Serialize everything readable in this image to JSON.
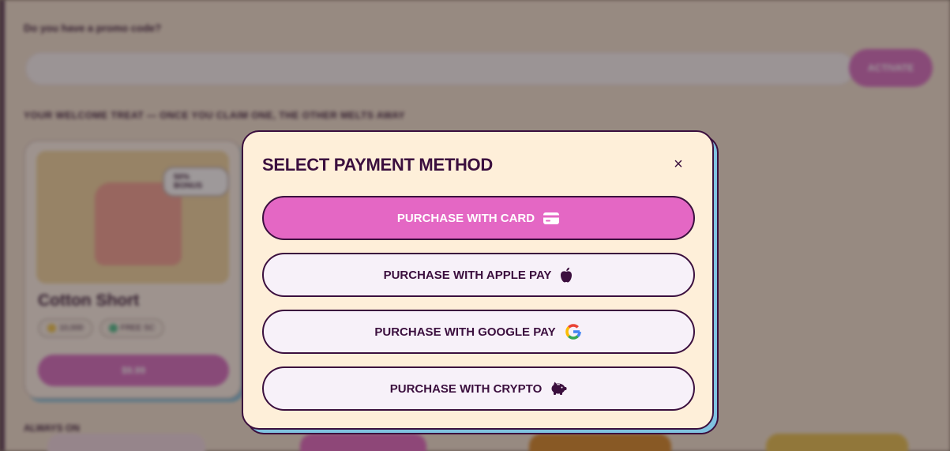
{
  "background": {
    "promo_question": "Do you have a promo code?",
    "promo_input_placeholder": "",
    "activate_label": "ACTIVATE",
    "welcome_heading": "YOUR WELCOME TREAT — ONCE YOU CLAIM ONE, THE OTHER MELTS AWAY",
    "offer": {
      "badge": "50% BONUS",
      "title": "Cotton Short",
      "chips": [
        {
          "label": "10,000",
          "icon": "coin-icon",
          "color": "#f2c94c"
        },
        {
          "label": "FREE SC",
          "icon": "sweep-coin-icon",
          "color": "#4fc08d"
        }
      ],
      "price": "$9.99"
    },
    "always_heading": "ALWAYS ON"
  },
  "modal": {
    "title": "SELECT PAYMENT METHOD",
    "close_icon": "×",
    "buttons": [
      {
        "label": "PURCHASE WITH CARD",
        "icon": "credit-card-icon"
      },
      {
        "label": "PURCHASE WITH APPLE PAY",
        "icon": "apple-icon"
      },
      {
        "label": "PURCHASE WITH GOOGLE PAY",
        "icon": "google-icon"
      },
      {
        "label": "PURCHASE WITH CRYPTO",
        "icon": "piggy-bank-icon"
      }
    ]
  },
  "colors": {
    "accent_pink": "#e467c4",
    "dark_purple": "#3b0f3e",
    "modal_bg": "#feefd9",
    "shadow_blue": "#7fc2e0"
  }
}
